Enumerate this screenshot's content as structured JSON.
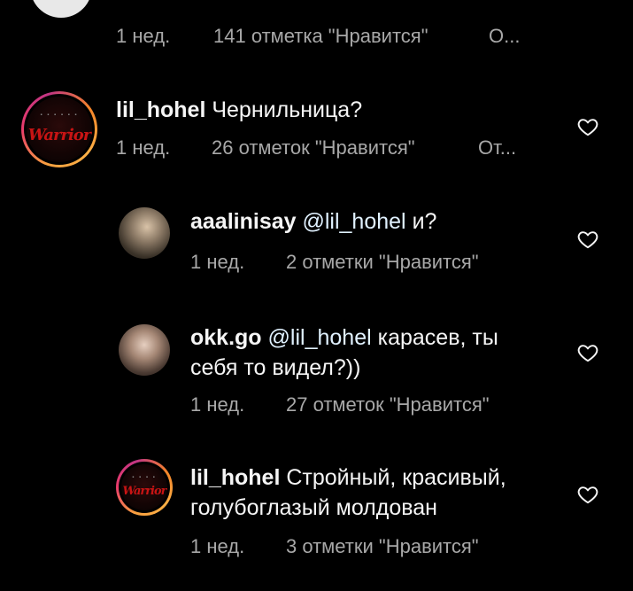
{
  "comments": [
    {
      "meta": {
        "time": "1 нед.",
        "likes": "141 отметка \"Нравится\"",
        "reply": "О..."
      }
    },
    {
      "username": "lil_hohel",
      "text": "Чернильница?",
      "meta": {
        "time": "1 нед.",
        "likes": "26 отметок \"Нравится\"",
        "reply": "От..."
      },
      "avatar_text": "Warrior"
    },
    {
      "username": "aaalinisay",
      "mention": "@lil_hohel",
      "text": "и?",
      "meta": {
        "time": "1 нед.",
        "likes": "2 отметки \"Нравится\""
      }
    },
    {
      "username": "okk.go",
      "mention": "@lil_hohel",
      "text_line1": "карасев, ты",
      "text_line2": "себя то видел?))",
      "meta": {
        "time": "1 нед.",
        "likes": "27 отметок \"Нравится\""
      }
    },
    {
      "username": "lil_hohel",
      "text_line1": "Стройный, красивый,",
      "text_line2": "голубоглазый молдован",
      "meta": {
        "time": "1 нед.",
        "likes": "3 отметки \"Нравится\""
      },
      "avatar_text": "Warrior"
    }
  ],
  "icons": {
    "like": "heart-outline-icon"
  },
  "colors": {
    "background": "#000000",
    "text": "#f5f5f5",
    "meta": "#a8a8a8",
    "mention": "#e0f1ff"
  }
}
